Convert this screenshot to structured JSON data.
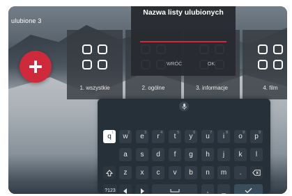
{
  "list_title": "ulubione 3",
  "add_button_icon": "plus-icon",
  "cards": [
    {
      "label": "1. wszystkie",
      "icon": "grid-icon"
    },
    {
      "label": "2. ogólne",
      "icon": "grid-icon"
    },
    {
      "label": "3. informacje",
      "icon": "grid-icon"
    },
    {
      "label": "4. film",
      "icon": "grid-icon"
    }
  ],
  "dialog": {
    "title": "Nazwa listy ulubionych",
    "input_value": "",
    "back_label": "WRÓĆ",
    "ok_label": "OK"
  },
  "keyboard": {
    "mic_icon": "microphone-icon",
    "row1": [
      {
        "key": "q",
        "hint": "1"
      },
      {
        "key": "w",
        "hint": "2"
      },
      {
        "key": "e",
        "hint": "3"
      },
      {
        "key": "r",
        "hint": "4"
      },
      {
        "key": "t",
        "hint": "5"
      },
      {
        "key": "y",
        "hint": "6"
      },
      {
        "key": "u",
        "hint": "7"
      },
      {
        "key": "i",
        "hint": "8"
      },
      {
        "key": "o",
        "hint": "9"
      },
      {
        "key": "p",
        "hint": "0"
      }
    ],
    "row2": [
      "a",
      "s",
      "d",
      "f",
      "g",
      "h",
      "j",
      "k",
      "l"
    ],
    "row3": [
      "z",
      "x",
      "c",
      "v",
      "b",
      "n",
      "m",
      ".",
      "-"
    ],
    "shift_icon": "shift-icon",
    "backspace_icon": "backspace-icon",
    "symbols_label": "?123",
    "left_icon": "arrow-left-icon",
    "right_icon": "arrow-right-icon",
    "space_icon": "space-icon",
    "comma_label": ",",
    "underscore_label": "_",
    "done_icon": "checkmark-icon",
    "focused_key": "q"
  },
  "colors": {
    "accent": "#cf2a3c",
    "keyboard_bg": "#263038",
    "key_bg": "#323d47",
    "key_focus": "#ffffff"
  }
}
